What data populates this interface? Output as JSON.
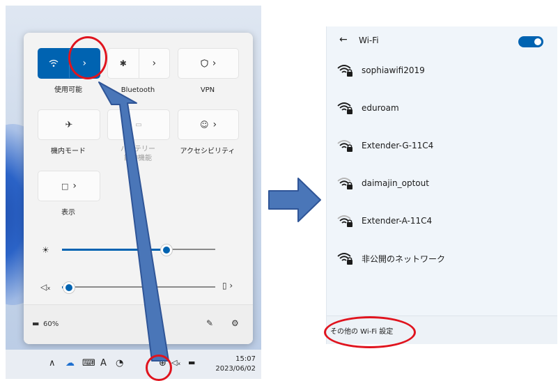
{
  "quick_settings": {
    "tiles": {
      "wifi": {
        "label": "使用可能",
        "state": "on",
        "icon": "wifi-icon",
        "expand_icon": "chevron-right-icon"
      },
      "bluetooth": {
        "label": "Bluetooth",
        "icon": "bluetooth-icon",
        "expand_icon": "chevron-right-icon"
      },
      "vpn": {
        "label": "VPN",
        "icon": "shield-icon",
        "expand_icon": "chevron-right-icon"
      },
      "airplane": {
        "label": "機内モード",
        "icon": "airplane-icon"
      },
      "battery_saver": {
        "label_line1": "バッテリー",
        "label_line2": "節約機能",
        "state": "disabled",
        "icon": "battery-saver-icon"
      },
      "accessibility": {
        "label": "アクセシビリティ",
        "icon": "accessibility-icon",
        "expand_icon": "chevron-right-icon"
      },
      "display": {
        "label": "表示",
        "icon": "display-icon",
        "expand_icon": "chevron-right-icon"
      }
    },
    "brightness": {
      "icon": "brightness-icon",
      "level": 0.68
    },
    "volume": {
      "icon": "speaker-muted-icon",
      "level": 0.02,
      "output_icon": "speaker-device-icon"
    },
    "footer": {
      "battery_text": "60%",
      "battery_icon": "battery-icon",
      "edit_icon": "pencil-icon",
      "settings_icon": "gear-icon"
    }
  },
  "taskbar": {
    "icons": [
      "chevron-up-icon",
      "cloud-icon",
      "keyboard-icon",
      "font-icon",
      "clock-icon",
      "globe-icon",
      "speaker-muted-icon",
      "battery-icon"
    ],
    "ime_text": "A",
    "time": "15:07",
    "date": "2023/06/02"
  },
  "wifi": {
    "back_icon": "arrow-left-icon",
    "title": "Wi-Fi",
    "toggle": "on",
    "networks": [
      {
        "name": "sophiawifi2019",
        "secured": true,
        "signal": 3
      },
      {
        "name": "eduroam",
        "secured": true,
        "signal": 3
      },
      {
        "name": "Extender-G-11C4",
        "secured": true,
        "signal": 2
      },
      {
        "name": "daimajin_optout",
        "secured": true,
        "signal": 2
      },
      {
        "name": "Extender-A-11C4",
        "secured": true,
        "signal": 2
      },
      {
        "name": "非公開のネットワーク",
        "secured": true,
        "signal": 3
      }
    ],
    "more_settings": "その他の Wi-Fi 設定"
  },
  "annotations": {
    "ring_color": "#e0141e",
    "arrow_color": "#4a76b8"
  }
}
